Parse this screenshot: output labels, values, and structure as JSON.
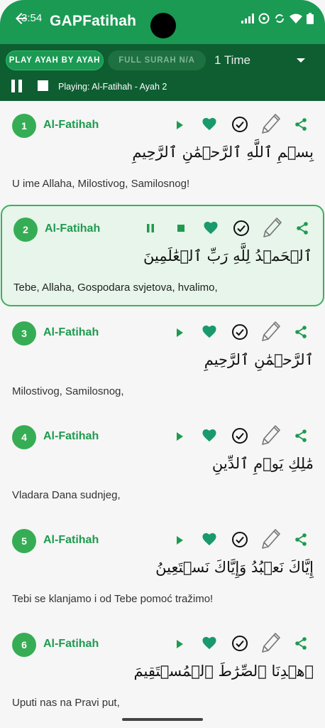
{
  "status_bar": {
    "time": "3:54"
  },
  "app_bar": {
    "title": "GAPFatihah",
    "back_icon": "arrow-left-icon"
  },
  "player": {
    "mode_ayah_label": "PLAY AYAH BY AYAH",
    "mode_surah_label": "FULL SURAH N/A",
    "repeat_value": "1 Time",
    "now_playing": "Playing: Al-Fatihah - Ayah 2"
  },
  "colors": {
    "app_bar": "#1a9a53",
    "player_bar": "#0e5e32",
    "accent": "#1f9a4f",
    "active_border": "#3bb161",
    "active_bg": "#e7f5ea",
    "heart": "#1a9a6c"
  },
  "ayahs": [
    {
      "number": "1",
      "surah": "Al-Fatihah",
      "arabic": "بِسۡمِ ٱللَّهِ ٱلرَّحۡمَٰنِ ٱلرَّحِيمِ",
      "translation": "U ime Allaha, Milostivog, Samilosnog!",
      "playing": false
    },
    {
      "number": "2",
      "surah": "Al-Fatihah",
      "arabic": "ٱلۡحَمۡدُ لِلَّهِ رَبِّ ٱلۡعَٰلَمِينَ",
      "translation": "Tebe, Allaha, Gospodara svjetova, hvalimo,",
      "playing": true
    },
    {
      "number": "3",
      "surah": "Al-Fatihah",
      "arabic": "ٱلرَّحۡمَٰنِ ٱلرَّحِيمِ",
      "translation": "Milostivog, Samilosnog,",
      "playing": false
    },
    {
      "number": "4",
      "surah": "Al-Fatihah",
      "arabic": "مَٰلِكِ يَوۡمِ ٱلدِّينِ",
      "translation": "Vladara Dana sudnjeg,",
      "playing": false
    },
    {
      "number": "5",
      "surah": "Al-Fatihah",
      "arabic": "إِيَّاكَ نَعۡبُدُ وَإِيَّاكَ نَسۡتَعِينُ",
      "translation": "Tebi se klanjamo i od Tebe pomoć tražimo!",
      "playing": false
    },
    {
      "number": "6",
      "surah": "Al-Fatihah",
      "arabic": "ٱهۡدِنَا ٱلصِّرَٰطَ ٱلۡمُسۡتَقِيمَ",
      "translation": "Uputi nas na Pravi put,",
      "playing": false
    }
  ]
}
